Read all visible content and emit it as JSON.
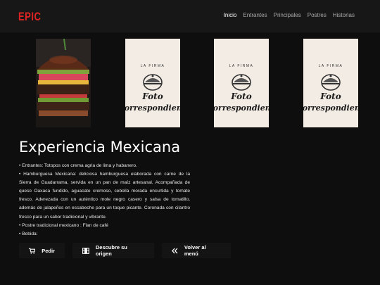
{
  "brand": {
    "logo": "EPIC"
  },
  "nav": {
    "items": [
      {
        "label": "Inicio",
        "active": true
      },
      {
        "label": "Entrantes",
        "active": false
      },
      {
        "label": "Principales",
        "active": false
      },
      {
        "label": "Postres",
        "active": false
      },
      {
        "label": "Historias",
        "active": false
      }
    ]
  },
  "gallery": {
    "placeholder": {
      "top_text": "LA FIRMA",
      "main_text": "Foto",
      "sub_text": "correspondiente"
    },
    "tiles": [
      {
        "kind": "photo",
        "icon": "burger-photo"
      },
      {
        "kind": "placeholder",
        "icon": "plate-dome-icon"
      },
      {
        "kind": "placeholder",
        "icon": "plate-dome-icon"
      },
      {
        "kind": "placeholder",
        "icon": "plate-dome-icon"
      }
    ]
  },
  "main": {
    "title": "Experiencia Mexicana",
    "description": [
      "• Entrantes: Totopos con crema agria de lima y habanero.",
      "• Hamburguesa Mexicana: deliciosa hamburguesa elaborada con carne de la Sierra de Guadarrama, servida en un pan de maíz artesanal. Acompañada de queso Oaxaca fundido, aguacate cremoso, cebolla morada encurtida y tomate fresco. Aderezada con un auténtico mole negro casero y salsa de tomatillo, además de jalapeños en escabeche para un toque picante. Coronada con cilantro fresco para un sabor tradicional y vibrante.",
      "• Postre tradicional mexicano : Flan de café",
      "• Bebida:"
    ]
  },
  "actions": {
    "order_label": "Pedir",
    "origin_label": "Descubre su origen",
    "back_label": "Volver al menú"
  },
  "colors": {
    "accent": "#e02424",
    "background": "#0e0e0e",
    "topbar": "#171717"
  }
}
